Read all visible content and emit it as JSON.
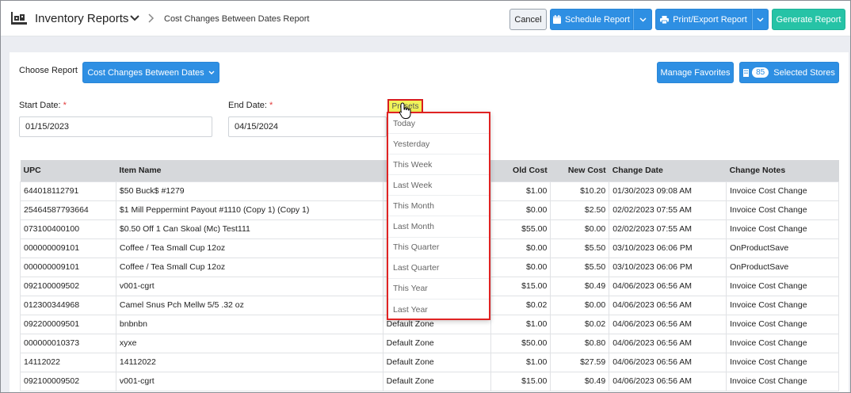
{
  "header": {
    "app_title": "Inventory Reports",
    "breadcrumb": "Cost Changes Between Dates Report",
    "cancel_label": "Cancel",
    "schedule_label": "Schedule Report",
    "print_label": "Print/Export Report",
    "generate_label": "Generate Report"
  },
  "controls": {
    "choose_label": "Choose Report",
    "report_select": "Cost Changes Between Dates",
    "favorites_label": "Manage Favorites",
    "stores_count": "85",
    "stores_label": "Selected Stores",
    "start_label": "Start Date:",
    "start_value": "01/15/2023",
    "end_label": "End Date:",
    "end_value": "04/15/2024",
    "presets_label": "Presets",
    "required_mark": "*"
  },
  "presets": [
    "Today",
    "Yesterday",
    "This Week",
    "Last Week",
    "This Month",
    "Last Month",
    "This Quarter",
    "Last Quarter",
    "This Year",
    "Last Year"
  ],
  "table": {
    "columns": [
      "UPC",
      "Item Name",
      "",
      "Old Cost",
      "New Cost",
      "Change Date",
      "Change Notes"
    ],
    "rows": [
      [
        "644018112791",
        "$50 Buck$ #1279",
        "",
        "$1.00",
        "$10.20",
        "01/30/2023 09:08 AM",
        "Invoice Cost Change"
      ],
      [
        "25464587793664",
        "$1 Mill Peppermint Payout #1110 (Copy 1) (Copy 1)",
        "",
        "$0.00",
        "$2.50",
        "02/02/2023 07:55 AM",
        "Invoice Cost Change"
      ],
      [
        "073100400100",
        "$0.50 Off 1 Can Skoal (Mc) Test111",
        "",
        "$55.00",
        "$0.00",
        "02/02/2023 07:55 AM",
        "Invoice Cost Change"
      ],
      [
        "000000009101",
        "Coffee / Tea Small Cup 12oz",
        "",
        "$0.00",
        "$5.50",
        "03/10/2023 06:06 PM",
        "OnProductSave"
      ],
      [
        "000000009101",
        "Coffee / Tea Small Cup 12oz",
        "",
        "$0.00",
        "$5.50",
        "03/10/2023 06:06 PM",
        "OnProductSave"
      ],
      [
        "092100009502",
        "v001-cgrt",
        "",
        "$15.00",
        "$0.49",
        "04/06/2023 06:56 AM",
        "Invoice Cost Change"
      ],
      [
        "012300344968",
        "Camel Snus Pch Mellw 5/5 .32 oz",
        "",
        "$0.02",
        "$0.00",
        "04/06/2023 06:56 AM",
        "Invoice Cost Change"
      ],
      [
        "092200009501",
        "bnbnbn",
        "Default Zone",
        "$1.00",
        "$0.02",
        "04/06/2023 06:56 AM",
        "Invoice Cost Change"
      ],
      [
        "000000010373",
        "xyxe",
        "Default Zone",
        "$50.00",
        "$0.80",
        "04/06/2023 06:56 AM",
        "Invoice Cost Change"
      ],
      [
        "14112022",
        "14112022",
        "Default Zone",
        "$1.00",
        "$27.59",
        "04/06/2023 06:56 AM",
        "Invoice Cost Change"
      ],
      [
        "092100009502",
        "v001-cgrt",
        "Default Zone",
        "$15.00",
        "$0.49",
        "04/06/2023 06:56 AM",
        "Invoice Cost Change"
      ]
    ]
  }
}
